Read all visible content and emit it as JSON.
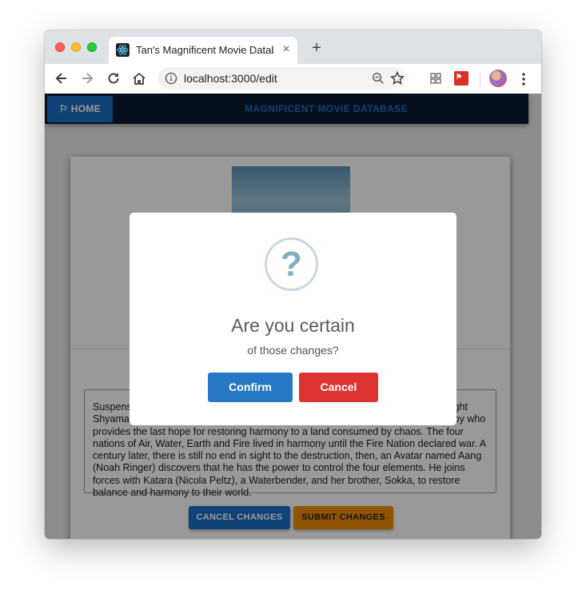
{
  "browser": {
    "tab_title": "Tan's Magnificent Movie Database",
    "tab_close": "×",
    "new_tab": "+",
    "url": "localhost:3000/edit"
  },
  "navbar": {
    "home_label": "⚐ HOME",
    "brand": "MAGNIFICENT MOVIE DATABASE"
  },
  "movie": {
    "description": "Suspense, action, and mystery meet in this fantasy adventure, as filmmaker M. Night Shyamalan pens and directs his own screenplays to tell the tale of a 12 year old boy who provides the last hope for restoring harmony to a land consumed by chaos.  The four nations of Air, Water, Earth and Fire lived in harmony until the Fire Nation declared war. A century later, there is still no end in sight to the destruction, then, an Avatar named Aang (Noah Ringer) discovers that he has the power to control the four elements. He joins forces with Katara (Nicola Peltz), a Waterbender, and her brother, Sokka, to restore balance and harmony to their world."
  },
  "actions": {
    "cancel_changes": "CANCEL CHANGES",
    "submit_changes": "SUBMIT CHANGES"
  },
  "modal": {
    "icon_glyph": "?",
    "title": "Are you certain",
    "text": "of those changes?",
    "confirm_label": "Confirm",
    "cancel_label": "Cancel"
  },
  "colors": {
    "navbar_bg": "#0a192f",
    "primary_blue": "#1c6fc6",
    "submit_orange": "#f08c00",
    "confirm_blue": "#2778c4",
    "cancel_red": "#dd3333"
  }
}
